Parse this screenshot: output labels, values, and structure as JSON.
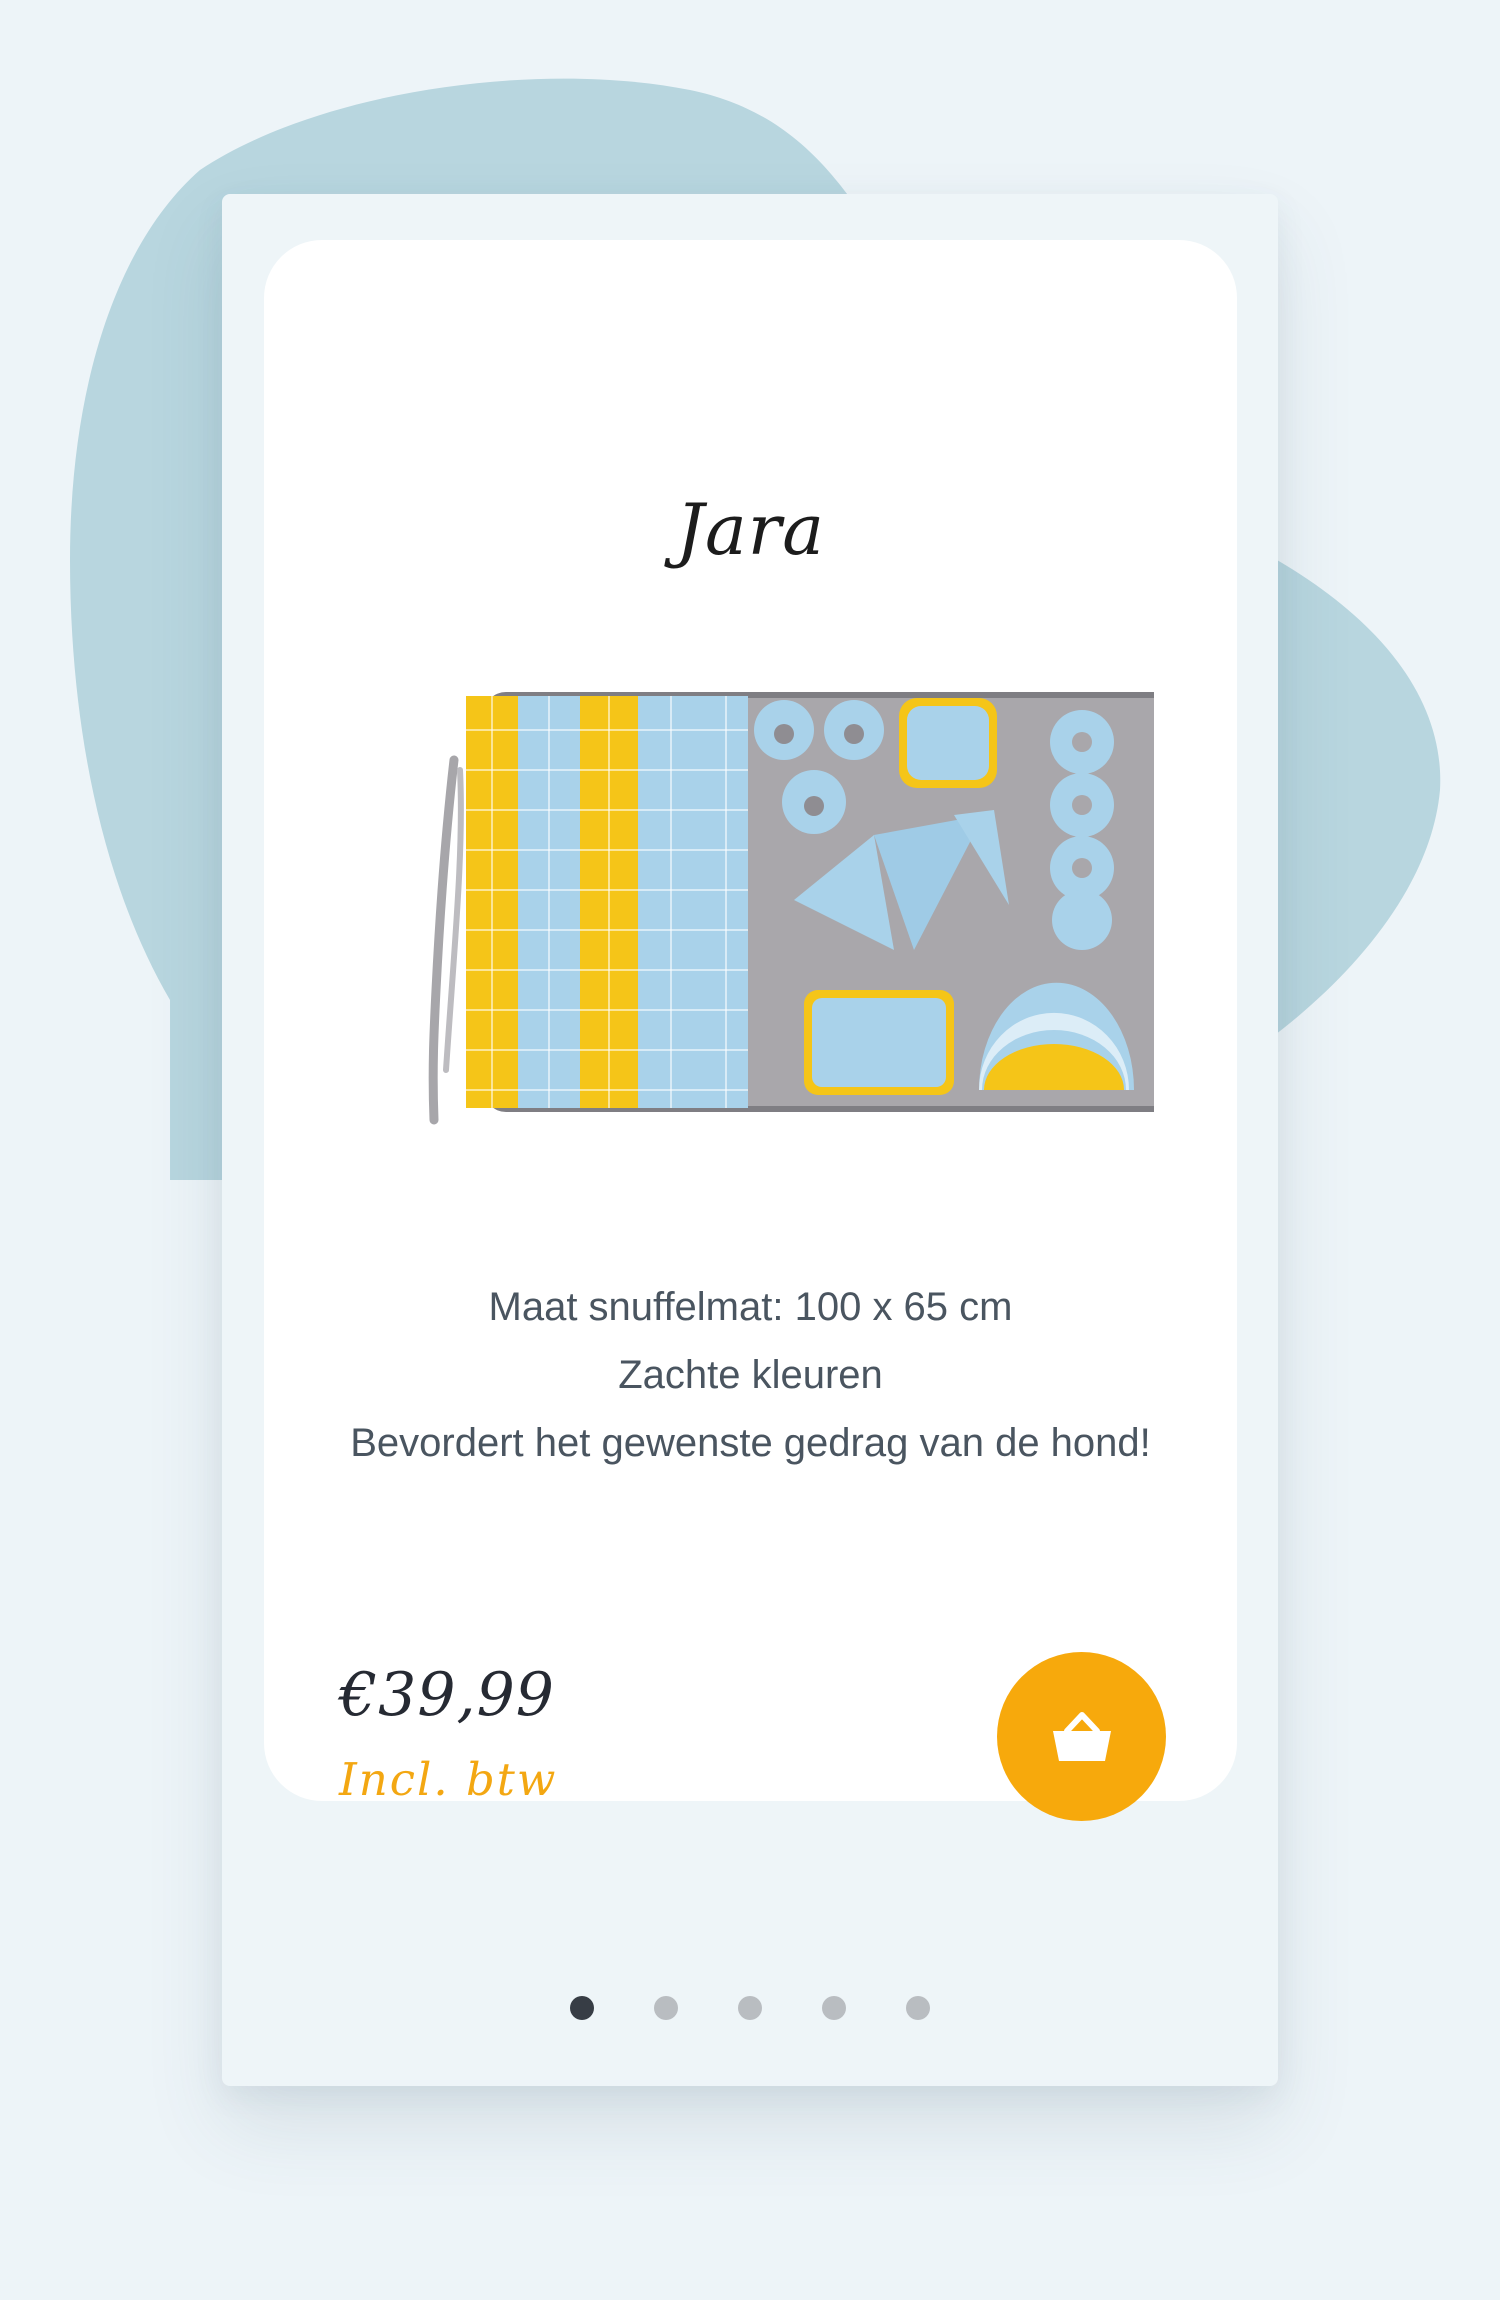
{
  "colors": {
    "background": "#edf4f8",
    "blob": "#b8d6df",
    "card": "#ffffff",
    "accent": "#f7a90c",
    "price_text": "#262a33",
    "description_text": "#4a5560",
    "active_dot": "#373d45",
    "inactive_dot": "#b9bdc1"
  },
  "product": {
    "name": "Jara",
    "image_icon": "snuffle-mat-image",
    "description": [
      "Maat snuffelmat: 100 x 65 cm",
      "Zachte kleuren",
      "Bevordert het gewenste gedrag van de hond!"
    ],
    "price": "€39,99",
    "vat_note": "Incl. btw",
    "cart_icon": "basket-icon"
  },
  "carousel": {
    "dot_count": 5,
    "active_index": 0
  }
}
